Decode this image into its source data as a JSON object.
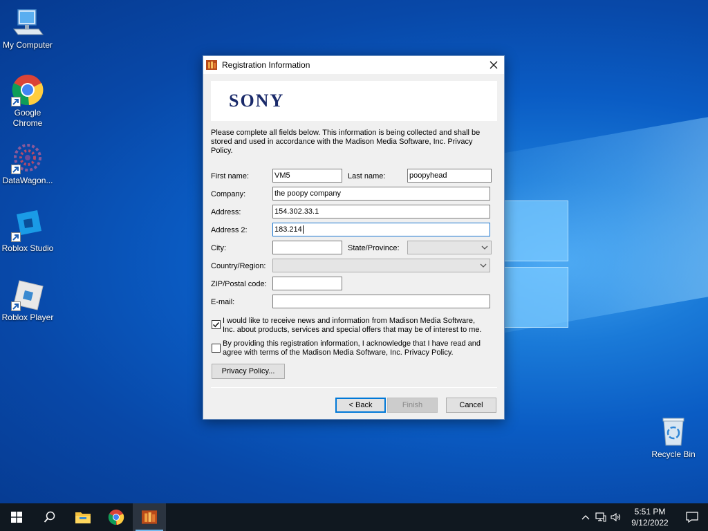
{
  "desktop": {
    "icons": [
      {
        "label": "My Computer"
      },
      {
        "label": "Google Chrome"
      },
      {
        "label": "DataWagon..."
      },
      {
        "label": "Roblox Studio"
      },
      {
        "label": "Roblox Player"
      },
      {
        "label": "Recycle Bin"
      }
    ]
  },
  "dialog": {
    "title": "Registration Information",
    "logo_text": "SONY",
    "intro": "Please complete all fields below. This information is being collected and shall be stored and used in accordance with the Madison Media Software, Inc. Privacy Policy.",
    "labels": {
      "first_name": "First name:",
      "last_name": "Last name:",
      "company": "Company:",
      "address": "Address:",
      "address2": "Address 2:",
      "city": "City:",
      "state": "State/Province:",
      "country": "Country/Region:",
      "zip": "ZIP/Postal code:",
      "email": "E-mail:"
    },
    "values": {
      "first_name": "VM5",
      "last_name": "poopyhead",
      "company": "the poopy company",
      "address": "154.302.33.1",
      "address2": "183.214",
      "city": "",
      "state": "",
      "country": "",
      "zip": "",
      "email": ""
    },
    "checkboxes": [
      {
        "label": "I would like to receive news and information from Madison Media Software, Inc. about products, services and special offers that may be of interest to me.",
        "checked": true
      },
      {
        "label": "By providing this registration information, I acknowledge that I have read and agree with terms of the Madison Media Software, Inc. Privacy Policy.",
        "checked": false
      }
    ],
    "buttons": {
      "privacy": "Privacy Policy...",
      "back": "< Back",
      "finish": "Finish",
      "cancel": "Cancel"
    }
  },
  "taskbar": {
    "time": "5:51 PM",
    "date": "9/12/2022"
  },
  "colors": {
    "accent": "#0078d7",
    "taskbar": "#101820"
  }
}
